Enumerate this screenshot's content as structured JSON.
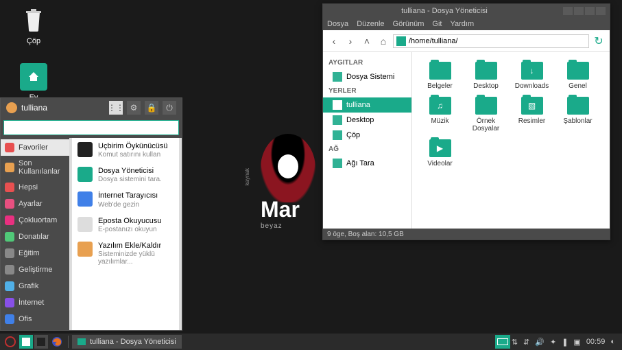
{
  "desktop": {
    "trash": "Çöp",
    "home": "Ev"
  },
  "bg": {
    "main": "Mar",
    "sub": "beyaz",
    "side": "kaynak"
  },
  "start_menu": {
    "user": "tulliana",
    "search_placeholder": "",
    "categories": [
      {
        "label": "Favoriler",
        "color": "#e85050",
        "active": true
      },
      {
        "label": "Son Kullanılanlar",
        "color": "#e8a050"
      },
      {
        "label": "Hepsi",
        "color": "#e85050"
      },
      {
        "label": "Ayarlar",
        "color": "#e85080"
      },
      {
        "label": "Çokluortam",
        "color": "#e83080"
      },
      {
        "label": "Donatılar",
        "color": "#50c878"
      },
      {
        "label": "Eğitim",
        "color": "#888"
      },
      {
        "label": "Geliştirme",
        "color": "#888"
      },
      {
        "label": "Grafik",
        "color": "#50b0e8"
      },
      {
        "label": "İnternet",
        "color": "#8850e8"
      },
      {
        "label": "Ofis",
        "color": "#4080e8"
      }
    ],
    "apps": [
      {
        "title": "Uçbirim Öykünücüsü",
        "desc": "Komut satırını kullan",
        "color": "#222"
      },
      {
        "title": "Dosya Yöneticisi",
        "desc": "Dosya sistemini tara.",
        "color": "#1aaa8a"
      },
      {
        "title": "İnternet Tarayıcısı",
        "desc": "Web'de gezin",
        "color": "#4080e8"
      },
      {
        "title": "Eposta Okuyucusu",
        "desc": "E-postanızı okuyun",
        "color": "#ddd"
      },
      {
        "title": "Yazılım Ekle/Kaldır",
        "desc": "Sisteminizde yüklü yazılımlar...",
        "color": "#e8a050"
      }
    ]
  },
  "fm": {
    "title": "tulliana - Dosya Yöneticisi",
    "menu": [
      "Dosya",
      "Düzenle",
      "Görünüm",
      "Git",
      "Yardım"
    ],
    "path": "/home/tulliana/",
    "side": {
      "devices_h": "AYGITLAR",
      "devices": [
        {
          "label": "Dosya Sistemi"
        }
      ],
      "places_h": "YERLER",
      "places": [
        {
          "label": "tulliana",
          "selected": true
        },
        {
          "label": "Desktop"
        },
        {
          "label": "Çöp"
        }
      ],
      "network_h": "AĞ",
      "network": [
        {
          "label": "Ağı Tara"
        }
      ]
    },
    "items": [
      {
        "label": "Belgeler",
        "glyph": ""
      },
      {
        "label": "Desktop",
        "glyph": ""
      },
      {
        "label": "Downloads",
        "glyph": "↓"
      },
      {
        "label": "Genel",
        "glyph": ""
      },
      {
        "label": "Müzik",
        "glyph": "♫"
      },
      {
        "label": "Örnek Dosyalar",
        "glyph": ""
      },
      {
        "label": "Resimler",
        "glyph": "▧"
      },
      {
        "label": "Şablonlar",
        "glyph": ""
      },
      {
        "label": "Videolar",
        "glyph": "▶"
      }
    ],
    "status": "9 öge, Boş alan: 10,5 GB"
  },
  "taskbar": {
    "task": "tulliana - Dosya Yöneticisi",
    "clock": "00:59"
  },
  "colors": {
    "accent": "#1aaa8a"
  }
}
